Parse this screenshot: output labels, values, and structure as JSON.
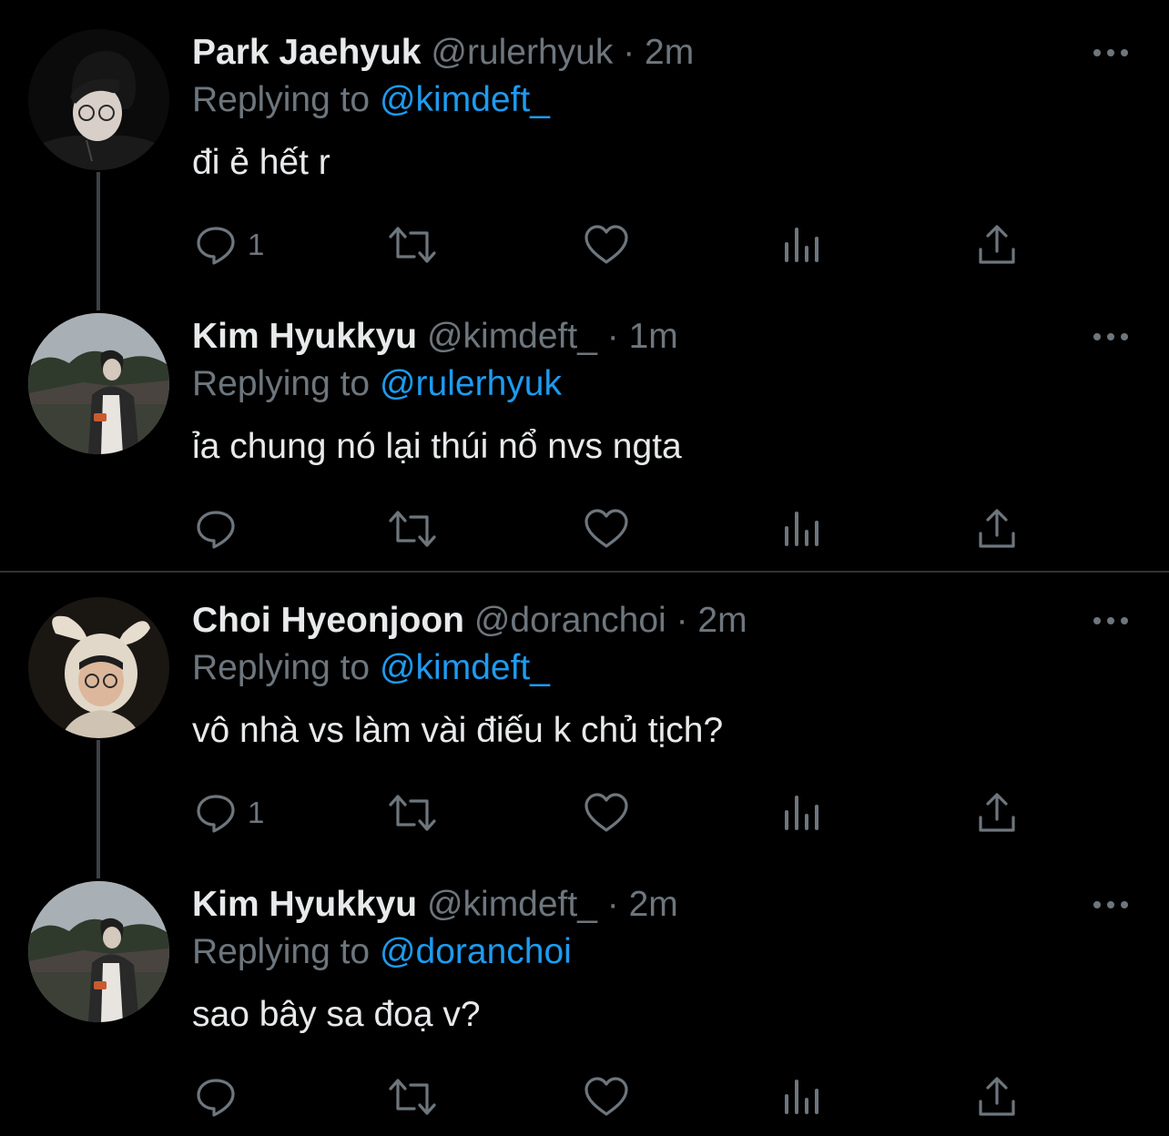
{
  "threads": [
    {
      "tweets": [
        {
          "name": "Park Jaehyuk",
          "handle": "@rulerhyuk",
          "dot": "·",
          "time": "2m",
          "replying_label": "Replying to ",
          "replying_to": "@kimdeft_",
          "text": "đi ẻ hết r",
          "reply_count": "1",
          "avatar": "person-glasses-dark-hair"
        },
        {
          "name": "Kim Hyukkyu",
          "handle": "@kimdeft_",
          "dot": "·",
          "time": "1m",
          "replying_label": "Replying to ",
          "replying_to": "@rulerhyuk",
          "text": "ỉa chung nó lại thúi nổ nvs ngta",
          "reply_count": "",
          "avatar": "person-outdoor-palace"
        }
      ]
    },
    {
      "tweets": [
        {
          "name": "Choi Hyeonjoon",
          "handle": "@doranchoi",
          "dot": "·",
          "time": "2m",
          "replying_label": "Replying to ",
          "replying_to": "@kimdeft_",
          "text": "vô nhà vs làm vài điếu k chủ tịch?",
          "reply_count": "1",
          "avatar": "person-bunny-ears-hat"
        },
        {
          "name": "Kim Hyukkyu",
          "handle": "@kimdeft_",
          "dot": "·",
          "time": "2m",
          "replying_label": "Replying to ",
          "replying_to": "@doranchoi",
          "text": "sao bây sa đoạ v?",
          "reply_count": "",
          "avatar": "person-outdoor-palace"
        }
      ]
    }
  ],
  "icons": {
    "reply": "reply-icon",
    "retweet": "retweet-icon",
    "like": "heart-icon",
    "analytics": "analytics-icon",
    "share": "share-icon",
    "more": "more-icon"
  },
  "colors": {
    "background": "#000000",
    "text": "#e7e9ea",
    "secondary": "#6e767d",
    "accent": "#1d9bf0",
    "divider": "#2f3336"
  }
}
